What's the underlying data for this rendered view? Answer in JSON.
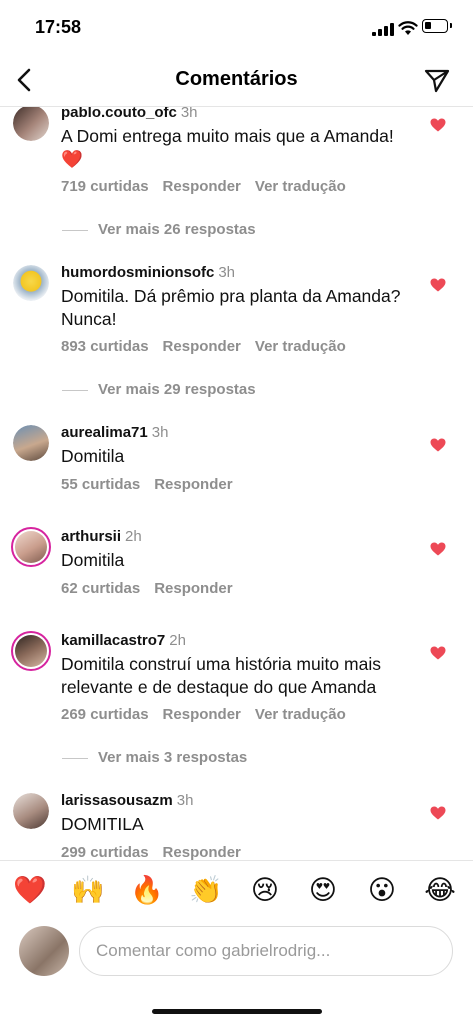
{
  "status_bar": {
    "time": "17:58"
  },
  "header": {
    "title": "Comentários"
  },
  "comments": [
    {
      "username": "pablo.couto_ofc",
      "time": "3h",
      "text": "A Domi entrega muito mais que a Amanda! ❤️",
      "likes": "719 curtidas",
      "reply": "Responder",
      "translate": "Ver tradução",
      "more_replies": "Ver mais 26 respostas"
    },
    {
      "username": "humordosminionsofc",
      "time": "3h",
      "text": "Domitila. Dá prêmio pra planta da Amanda? Nunca!",
      "likes": "893 curtidas",
      "reply": "Responder",
      "translate": "Ver tradução",
      "more_replies": "Ver mais 29 respostas"
    },
    {
      "username": "aurealima71",
      "time": "3h",
      "text": "Domitila",
      "likes": "55 curtidas",
      "reply": "Responder"
    },
    {
      "username": "arthursii",
      "time": "2h",
      "text": "Domitila",
      "likes": "62 curtidas",
      "reply": "Responder"
    },
    {
      "username": "kamillacastro7",
      "time": "2h",
      "text": "Domitila construí uma história muito mais relevante e de destaque do que Amanda",
      "likes": "269 curtidas",
      "reply": "Responder",
      "translate": "Ver tradução",
      "more_replies": "Ver mais 3 respostas"
    },
    {
      "username": "larissasousazm",
      "time": "3h",
      "text": "DOMITILA",
      "likes": "299 curtidas",
      "reply": "Responder"
    }
  ],
  "reactions": [
    "❤️",
    "🙌",
    "🔥",
    "👏",
    "😢",
    "😍",
    "😮",
    "😂"
  ],
  "composer": {
    "placeholder": "Comentar como gabrielrodrig..."
  },
  "colors": {
    "like_red": "#ed4956",
    "story_ring": "#d6249f",
    "muted_text": "#8e8e8e"
  }
}
